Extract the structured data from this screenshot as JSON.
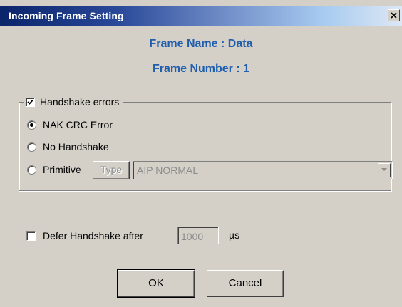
{
  "window": {
    "title": "Incoming Frame Setting",
    "close_symbol": "×"
  },
  "header": {
    "frame_name": "Frame Name : Data",
    "frame_number": "Frame Number : 1"
  },
  "handshake_group": {
    "checkbox_label": "Handshake errors",
    "checked": true,
    "options": [
      {
        "label": "NAK CRC Error",
        "selected": true
      },
      {
        "label": "No Handshake",
        "selected": false
      },
      {
        "label": "Primitive",
        "selected": false
      }
    ],
    "type_button_label": "Type",
    "primitive_select_value": "AIP NORMAL"
  },
  "defer": {
    "checkbox_label": "Defer Handshake after",
    "checked": false,
    "value": "1000",
    "unit": "µs"
  },
  "buttons": {
    "ok": "OK",
    "cancel": "Cancel"
  },
  "icons": {
    "close": "close-icon",
    "check": "checkmark-icon",
    "dropdown": "chevron-down-icon"
  },
  "colors": {
    "title_bar_start": "#0a246a",
    "title_bar_end": "#dde7f4",
    "frame_info_text": "#1f5fae",
    "dialog_face": "#d4d0c8",
    "disabled_text": "#8c8c8c"
  }
}
